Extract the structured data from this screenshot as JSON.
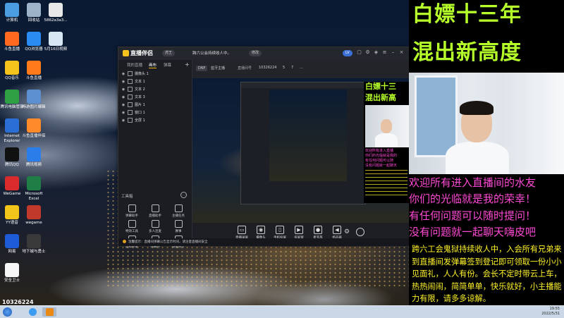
{
  "desktop": {
    "icons": [
      {
        "label": "计算机",
        "color": "#4a9de0"
      },
      {
        "label": "回收站",
        "color": "#9db3c8"
      },
      {
        "label": "5862a3a3...",
        "color": "#e8e8e8"
      },
      {
        "label": "斗鱼直播",
        "color": "#ff6a1f"
      },
      {
        "label": "QQ浏览器",
        "color": "#2a8bf2"
      },
      {
        "label": "5月16日视频",
        "color": "#d7e7f3"
      },
      {
        "label": "QQ音乐",
        "color": "#f3c21b"
      },
      {
        "label": "斗鱼直播",
        "color": "#ff7a1a"
      },
      {
        "label": "腾讯电脑管家",
        "color": "#2ea043"
      },
      {
        "label": "畅游图片编辑",
        "color": "#5c8fd0"
      },
      {
        "label": "Internet Explorer",
        "color": "#2a6fd6"
      },
      {
        "label": "斗鱼直播伴侣",
        "color": "#ff8a2a"
      },
      {
        "label": "腾讯QQ",
        "color": "#111111"
      },
      {
        "label": "腾讯视频",
        "color": "#2b7de9"
      },
      {
        "label": "WeGame",
        "color": "#d92b2b"
      },
      {
        "label": "Microsoft Excel",
        "color": "#1e7e45"
      },
      {
        "label": "YY语音",
        "color": "#f0c419"
      },
      {
        "label": "wegame",
        "color": "#c0392b"
      },
      {
        "label": "网易",
        "color": "#1e5bd6"
      },
      {
        "label": "地下城与勇士",
        "color": "#3a3a3a"
      },
      {
        "label": "安全卫士",
        "color": "#f7f7f7"
      }
    ],
    "overlay_number": "10326224"
  },
  "taskbar": {
    "time": "19:55",
    "date": "2022/5/31",
    "buttons": [
      {
        "name": "start",
        "color": "#2a6fd6"
      },
      {
        "name": "qq-browser",
        "color": "#3a9bf0"
      },
      {
        "name": "obs-app",
        "color": "#e98a16"
      }
    ]
  },
  "obs": {
    "logo_text": "直播伴侣",
    "user_chip": "虎王",
    "room_title": "跨六公会持续收人中。",
    "edit_btn": "修改",
    "level_chip": "LV",
    "tabs": [
      "我的直播",
      "画布",
      "弹幕"
    ],
    "sources": [
      "摄像头 1",
      "文本 1",
      "文本 2",
      "文本 3",
      "图片 1",
      "窗口 1",
      "全屏 1"
    ],
    "tools_title": "工具箱",
    "tools": [
      {
        "label": "弹幕助手"
      },
      {
        "label": "直播助手"
      },
      {
        "label": "主播任务"
      },
      {
        "label": "特效工具"
      },
      {
        "label": "多人连麦"
      },
      {
        "label": "赛事"
      },
      {
        "label": "虚拟形象"
      },
      {
        "label": "弹幕吧"
      },
      {
        "label": "数据统计"
      }
    ],
    "info": {
      "category": "DNF",
      "category_value": "蓝牙主播",
      "room_label": "直播间号",
      "room_id": "10326224",
      "viewers": "5",
      "likes": "7",
      "extra": "..."
    },
    "bottom_tools": [
      {
        "label": "直播录屏",
        "glyph": "▭"
      },
      {
        "label": "摄像头",
        "glyph": "◉"
      },
      {
        "label": "手机投屏",
        "glyph": "▯"
      },
      {
        "label": "投屏窗",
        "glyph": "▶"
      },
      {
        "label": "麦克风",
        "glyph": "●"
      },
      {
        "label": "扬声器",
        "glyph": "◀"
      }
    ],
    "status_strip": "温馨提示：直播间弹幕公告显示时间，请注意直播间安全"
  },
  "overlay": {
    "title_line1": "白嫖十三年",
    "title_line2": "混出新高度",
    "pink_lines": [
      "欢迎所有进入直播间的水友",
      "你们的光临就是我的荣幸！",
      "有任何问题可以随时提问！",
      "没有问题就一起聊天嗨皮吧"
    ],
    "yellow_text": "跨六工会鬼狱持续收人中，入会所有兄弟来到直播间发弹幕签到登记即可领取一份小小见面礼，人人有份。会长不定时带云上车，热热闹闹，简简单单，快乐就好，小主播能力有限，请多多谅解。"
  },
  "preview": {
    "mini_title1": "白嫖十三",
    "mini_title2": "混出新高",
    "mini_pink": [
      "欢迎所有进入直播",
      "你们的光临就是我的",
      "有任何问题可以随",
      "没有问题就一起聊天"
    ]
  },
  "colors": {
    "overlay_title": "#b6ff2a",
    "overlay_pink": "#ff49d5",
    "overlay_yellow": "#fff42a",
    "accent": "#e9b714"
  }
}
